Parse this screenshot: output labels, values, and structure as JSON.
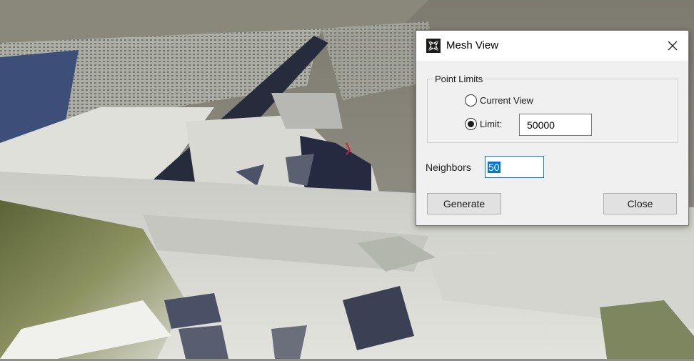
{
  "dialog": {
    "title": "Mesh View",
    "icon": "mesh-app-icon",
    "close_icon": "close-icon"
  },
  "point_limits": {
    "legend": "Point Limits",
    "current_view_label": "Current View",
    "limit_label": "Limit:",
    "limit_value": "50000",
    "selected": "limit"
  },
  "neighbors": {
    "label": "Neighbors",
    "value": "50"
  },
  "buttons": {
    "generate": "Generate",
    "close": "Close"
  },
  "colors": {
    "accent": "#0078d7",
    "dialog_bg": "#f0f0f0",
    "button_bg": "#e1e1e1"
  }
}
